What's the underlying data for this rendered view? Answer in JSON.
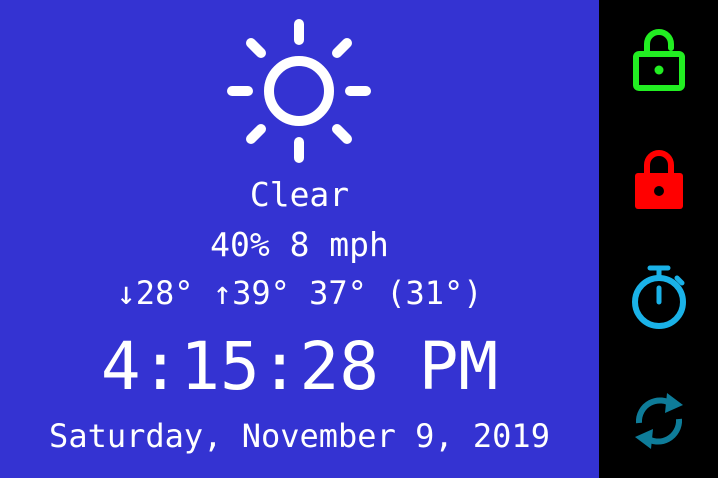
{
  "weather": {
    "icon": "sun-icon",
    "condition": "Clear",
    "humidity_wind": "40% 8 mph",
    "low_arrow": "↓",
    "low": "28°",
    "high_arrow": "↑",
    "high": "39°",
    "current": "37°",
    "feels_like": "(31°)"
  },
  "clock": {
    "time": "4:15:28 PM",
    "date": "Saturday, November 9, 2019"
  },
  "sidebar": {
    "unlock_icon": "unlock-icon",
    "lock_icon": "lock-icon",
    "timer_icon": "stopwatch-icon",
    "refresh_icon": "refresh-icon"
  },
  "colors": {
    "background": "#3433d2",
    "sidebar": "#000000",
    "unlock": "#22ee22",
    "lock": "#ff0000",
    "timer": "#1ab2e8",
    "refresh": "#0e7c99"
  }
}
